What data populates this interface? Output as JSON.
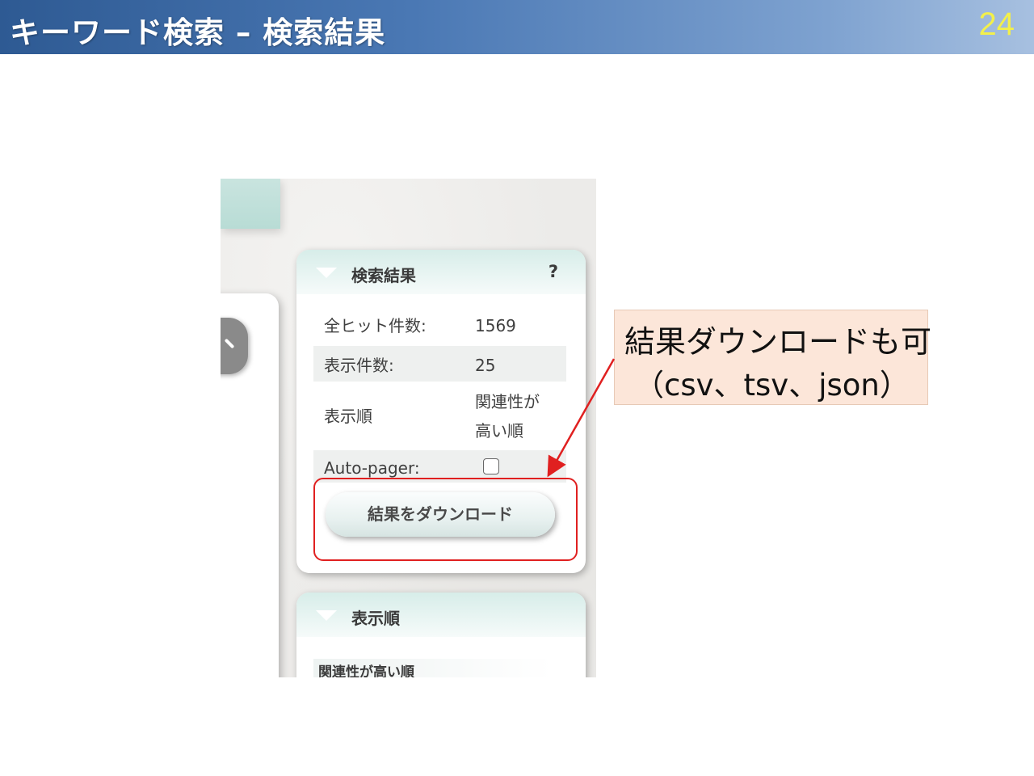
{
  "slide": {
    "title": "キーワード検索 – 検索結果",
    "page_number": "24",
    "colors": {
      "header_start": "#2e5a93",
      "header_end": "#a7c0e0",
      "page_number": "#f3f04a",
      "highlight": "#e02020",
      "callout_bg": "#fce6d9"
    }
  },
  "results_panel": {
    "title": "検索結果",
    "help": "?",
    "rows": [
      {
        "label": "全ヒット件数:",
        "value": "1569"
      },
      {
        "label": "表示件数:",
        "value": "25"
      },
      {
        "label": "表示順",
        "value_line1": "関連性が",
        "value_line2": "高い順"
      },
      {
        "label": "Auto-pager:",
        "checked": false
      }
    ],
    "download_button": "結果をダウンロード"
  },
  "order_panel": {
    "title": "表示順",
    "selected": "関連性が高い順"
  },
  "callout": {
    "line1": "結果ダウンロードも可",
    "line2": "（csv、tsv、json）"
  },
  "icons": [
    "triangle-icon",
    "help-icon",
    "search-icon",
    "checkbox"
  ]
}
